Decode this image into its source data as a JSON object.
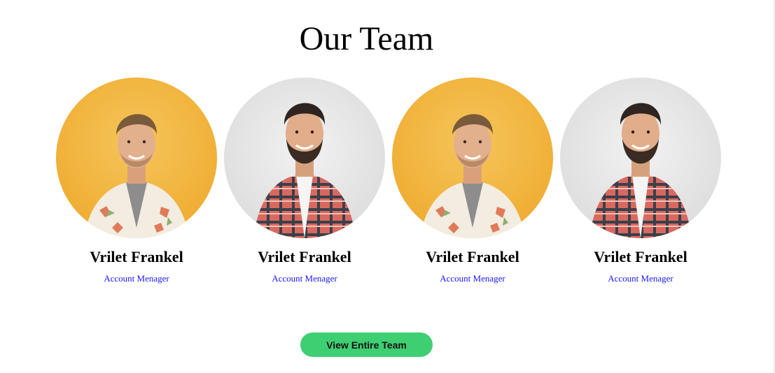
{
  "page": {
    "title": "Our Team"
  },
  "team": [
    {
      "name": "Vrilet Frankel",
      "role": "Account Menager",
      "avatar_icon": "portrait-yellow-background",
      "bg": "#f2b441"
    },
    {
      "name": "Vrilet Frankel",
      "role": "Account Menager",
      "avatar_icon": "portrait-grey-background",
      "bg": "#e4e4e4"
    },
    {
      "name": "Vrilet Frankel",
      "role": "Account Menager",
      "avatar_icon": "portrait-yellow-background",
      "bg": "#f2b441"
    },
    {
      "name": "Vrilet Frankel",
      "role": "Account Menager",
      "avatar_icon": "portrait-grey-background",
      "bg": "#e4e4e4"
    }
  ],
  "cta": {
    "label": "View Entire Team",
    "color": "#3fcf73"
  }
}
